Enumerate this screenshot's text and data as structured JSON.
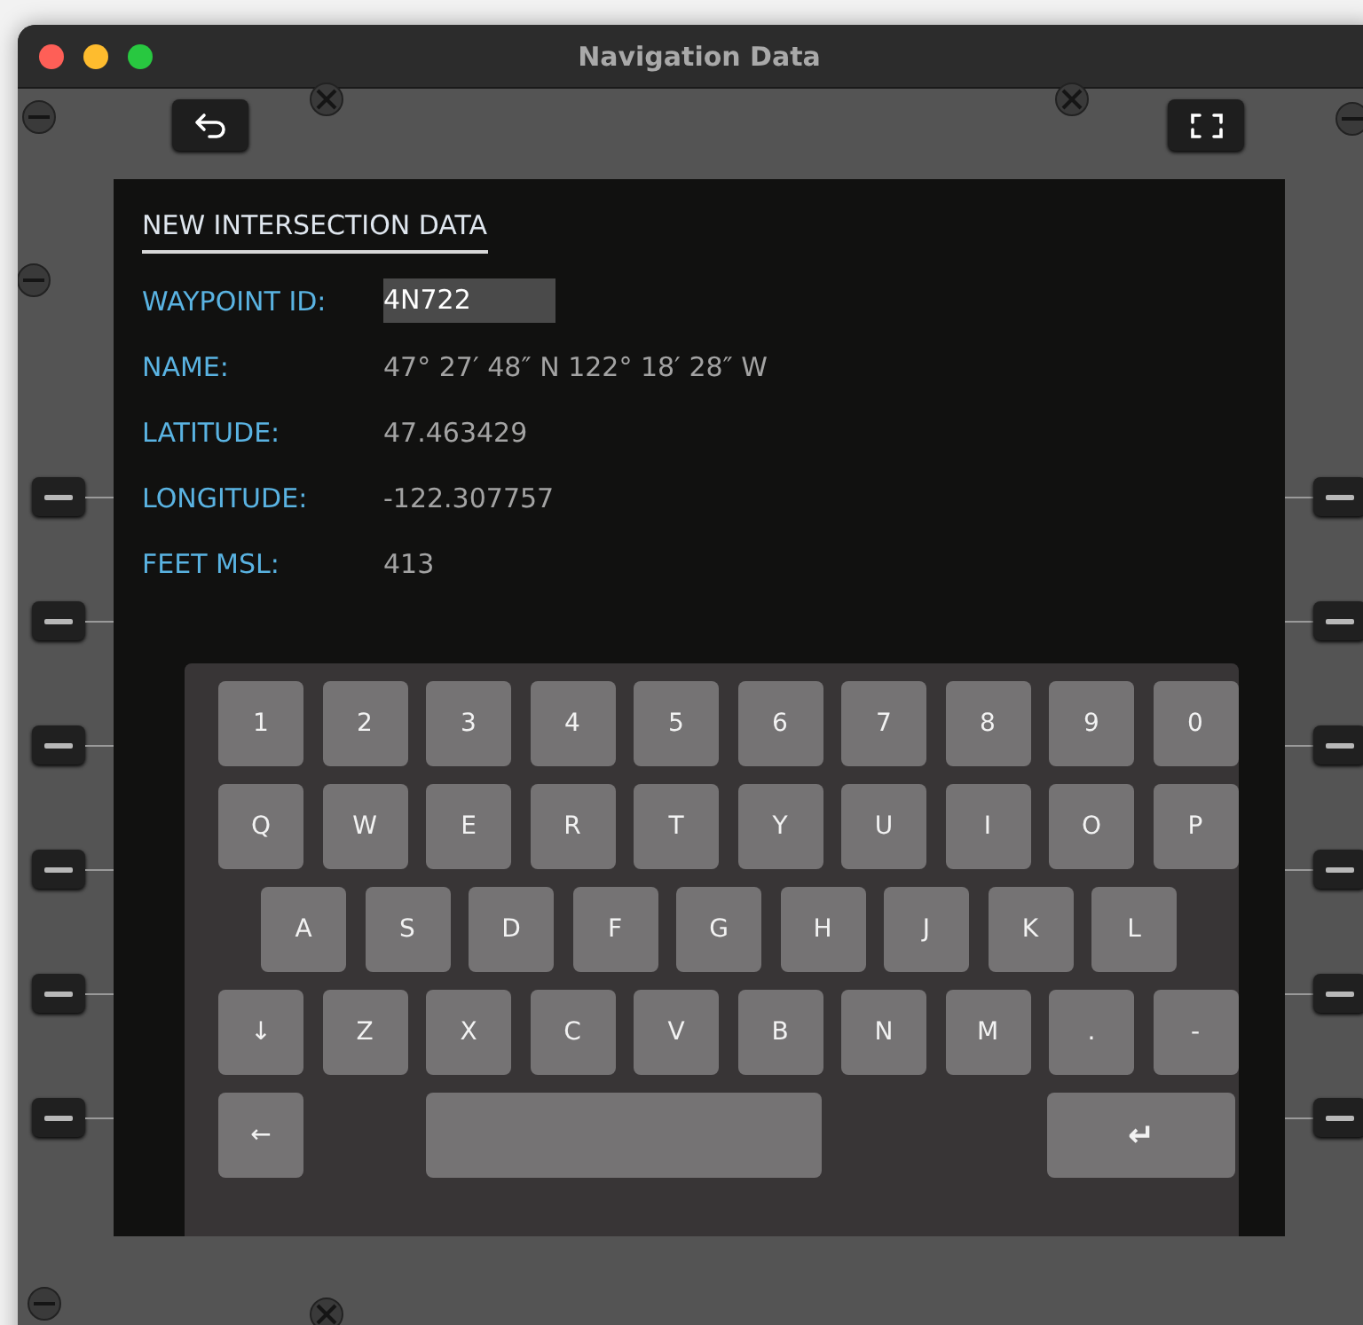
{
  "window": {
    "title": "Navigation Data"
  },
  "form": {
    "title": "NEW INTERSECTION DATA",
    "fields": [
      {
        "label": "WAYPOINT ID:",
        "value": "4N722",
        "selected": true
      },
      {
        "label": "NAME:",
        "value": "47° 27′ 48″ N 122° 18′ 28″ W",
        "selected": false
      },
      {
        "label": "LATITUDE:",
        "value": "47.463429",
        "selected": false
      },
      {
        "label": "LONGITUDE:",
        "value": "-122.307757",
        "selected": false
      },
      {
        "label": "FEET MSL:",
        "value": "413",
        "selected": false
      }
    ]
  },
  "keyboard": {
    "rows": [
      [
        {
          "kind": "key",
          "label": "1"
        },
        {
          "kind": "key",
          "label": "2"
        },
        {
          "kind": "key",
          "label": "3"
        },
        {
          "kind": "key",
          "label": "4"
        },
        {
          "kind": "key",
          "label": "5"
        },
        {
          "kind": "key",
          "label": "6"
        },
        {
          "kind": "key",
          "label": "7"
        },
        {
          "kind": "key",
          "label": "8"
        },
        {
          "kind": "key",
          "label": "9"
        },
        {
          "kind": "key",
          "label": "0"
        }
      ],
      [
        {
          "kind": "key",
          "label": "Q"
        },
        {
          "kind": "key",
          "label": "W"
        },
        {
          "kind": "key",
          "label": "E"
        },
        {
          "kind": "key",
          "label": "R"
        },
        {
          "kind": "key",
          "label": "T"
        },
        {
          "kind": "key",
          "label": "Y"
        },
        {
          "kind": "key",
          "label": "U"
        },
        {
          "kind": "key",
          "label": "I"
        },
        {
          "kind": "key",
          "label": "O"
        },
        {
          "kind": "key",
          "label": "P"
        }
      ],
      [
        {
          "kind": "key",
          "label": "A"
        },
        {
          "kind": "key",
          "label": "S"
        },
        {
          "kind": "key",
          "label": "D"
        },
        {
          "kind": "key",
          "label": "F"
        },
        {
          "kind": "key",
          "label": "G"
        },
        {
          "kind": "key",
          "label": "H"
        },
        {
          "kind": "key",
          "label": "J"
        },
        {
          "kind": "key",
          "label": "K"
        },
        {
          "kind": "key",
          "label": "L"
        }
      ],
      [
        {
          "kind": "key",
          "label": "↓"
        },
        {
          "kind": "key",
          "label": "Z"
        },
        {
          "kind": "key",
          "label": "X"
        },
        {
          "kind": "key",
          "label": "C"
        },
        {
          "kind": "key",
          "label": "V"
        },
        {
          "kind": "key",
          "label": "B"
        },
        {
          "kind": "key",
          "label": "N"
        },
        {
          "kind": "key",
          "label": "M"
        },
        {
          "kind": "key",
          "label": "."
        },
        {
          "kind": "key",
          "label": "-"
        }
      ],
      [
        {
          "kind": "key",
          "label": "←"
        },
        {
          "kind": "space"
        },
        {
          "kind": "enter",
          "label": "↵"
        }
      ]
    ]
  }
}
